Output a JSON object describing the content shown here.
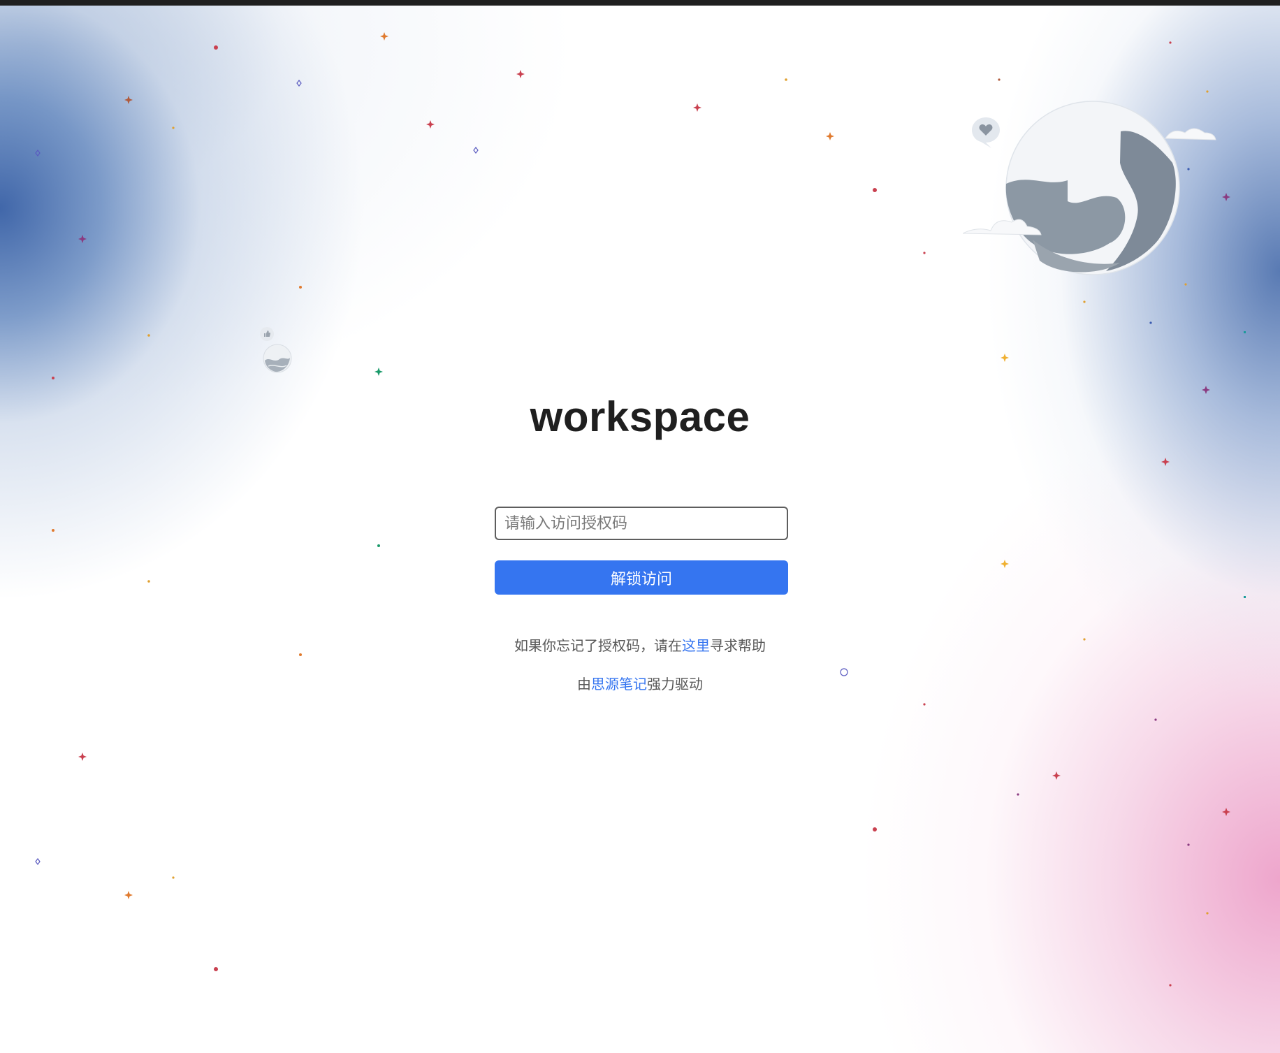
{
  "page": {
    "title": "workspace"
  },
  "auth": {
    "placeholder": "请输入访问授权码",
    "value": "",
    "unlock_label": "解锁访问"
  },
  "forgot": {
    "prefix": "如果你忘记了授权码，请在",
    "link": "这里",
    "suffix": "寻求帮助"
  },
  "powered": {
    "prefix": "由",
    "link": "思源笔记",
    "suffix": "强力驱动"
  },
  "colors": {
    "accent": "#3575f0",
    "title": "#1f1f1f",
    "hint_text": "#595959"
  },
  "icons": {
    "globe": "globe-illustration",
    "heart_bubble": "heart-bubble-icon",
    "small_globe": "small-globe-icon",
    "thumb_bubble": "thumbs-up-bubble-icon",
    "stars": "sparkle-stars"
  }
}
